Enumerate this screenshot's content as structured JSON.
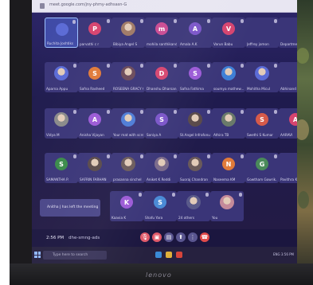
{
  "photo_subject": "laptop-screen-video-call",
  "browser": {
    "url_text": "meet.google.com/jny-phmy-adhsasn-G"
  },
  "participants": [
    {
      "name": "Ruchita Joshtiks",
      "initial": "",
      "color": "#3f4aa6",
      "kind": "self"
    },
    {
      "name": "parvathi c r",
      "initial": "P",
      "color": "#d6446f",
      "kind": "letter"
    },
    {
      "name": "Bibiya Angel S",
      "initial": "",
      "color": "#a07a66",
      "kind": "photo"
    },
    {
      "name": "mohila santhikand...",
      "initial": "m",
      "color": "#c94a92",
      "kind": "letter"
    },
    {
      "name": "Amala A.K",
      "initial": "A",
      "color": "#7a54c8",
      "kind": "letter"
    },
    {
      "name": "Varun Babu",
      "initial": "V",
      "color": "#d6446f",
      "kind": "letter"
    },
    {
      "name": "Jeffrey jomon",
      "initial": "",
      "color": "#3a3578",
      "kind": "blank"
    },
    {
      "name": "Department of E...",
      "initial": "",
      "color": "#3a3578",
      "kind": "blank"
    },
    {
      "name": "Aparna Appu",
      "initial": "",
      "color": "#5b6bd6",
      "kind": "photo"
    },
    {
      "name": "Safna Rasheed",
      "initial": "S",
      "color": "#e07a3a",
      "kind": "letter"
    },
    {
      "name": "ROSEENA GRACY G",
      "initial": "",
      "color": "#6b4a5a",
      "kind": "photo"
    },
    {
      "name": "Dhanshu Dharsan...",
      "initial": "D",
      "color": "#d6446f",
      "kind": "letter"
    },
    {
      "name": "Safna Fathima",
      "initial": "S",
      "color": "#9b5ad6",
      "kind": "letter"
    },
    {
      "name": "soumya mathew...",
      "initial": "",
      "color": "#3f7fd6",
      "kind": "photo"
    },
    {
      "name": "Mohitha Micul",
      "initial": "",
      "color": "#5b6bd6",
      "kind": "photo"
    },
    {
      "name": "Abhinand",
      "initial": "",
      "color": "#3a3578",
      "kind": "blank"
    },
    {
      "name": "Vidya M",
      "initial": "",
      "color": "#8a8a8a",
      "kind": "photo"
    },
    {
      "name": "Anisha Vijayan",
      "initial": "A",
      "color": "#9b5ad6",
      "kind": "letter"
    },
    {
      "name": "Your mat with screenshot",
      "initial": "",
      "color": "#4d7bd6",
      "kind": "photo"
    },
    {
      "name": "Soniya A",
      "initial": "S",
      "color": "#7a54c8",
      "kind": "letter"
    },
    {
      "name": "St.Angel Infrafonul",
      "initial": "",
      "color": "#5a4a4a",
      "kind": "photo"
    },
    {
      "name": "Athira TB",
      "initial": "",
      "color": "#6a7a6a",
      "kind": "photo"
    },
    {
      "name": "Swethi S Kumar",
      "initial": "S",
      "color": "#d65a4a",
      "kind": "letter"
    },
    {
      "name": "AARAVI",
      "initial": "A",
      "color": "#d6446f",
      "kind": "letter"
    },
    {
      "name": "SAMANTHA P.",
      "initial": "S",
      "color": "#3a8a4a",
      "kind": "letter"
    },
    {
      "name": "SAFRIN FARHAN",
      "initial": "",
      "color": "#5a4a4a",
      "kind": "photo"
    },
    {
      "name": "prasanna sinchel",
      "initial": "",
      "color": "#6a5a5a",
      "kind": "photo"
    },
    {
      "name": "Aniket K Reddi",
      "initial": "",
      "color": "#7a6a8a",
      "kind": "photo"
    },
    {
      "name": "Suoraj Chandran",
      "initial": "",
      "color": "#6a5a5a",
      "kind": "photo"
    },
    {
      "name": "Naseema KM",
      "initial": "N",
      "color": "#e07a3a",
      "kind": "letter"
    },
    {
      "name": "Gowtham Gowrik...",
      "initial": "G",
      "color": "#4a8a5a",
      "kind": "letter"
    },
    {
      "name": "Pavithra Kotaikor",
      "initial": "",
      "color": "#3a8a4a",
      "kind": "blank"
    },
    {
      "name": "Kaavia K",
      "initial": "K",
      "color": "#9b5ad6",
      "kind": "letter"
    },
    {
      "name": "Shafu Yara",
      "initial": "S",
      "color": "#4a8ad6",
      "kind": "letter"
    },
    {
      "name": "24 others",
      "initial": "",
      "color": "#5a5a8a",
      "kind": "photo"
    },
    {
      "name": "You",
      "initial": "",
      "color": "#c48a9a",
      "kind": "photo"
    }
  ],
  "notice": {
    "text": "Anitha J has left the meeting"
  },
  "footer": {
    "time": "2:56 PM",
    "meeting_code": "dhe-smng-ads"
  },
  "controls": [
    {
      "name": "mic-off-button",
      "color": "#e05a6a",
      "glyph": "🎙"
    },
    {
      "name": "camera-off-button",
      "color": "#e05a6a",
      "glyph": "▣"
    },
    {
      "name": "captions-button",
      "color": "#5a5690",
      "glyph": "▤"
    },
    {
      "name": "present-button",
      "color": "#5a5690",
      "glyph": "⬆"
    },
    {
      "name": "more-options-button",
      "color": "#5a5690",
      "glyph": "⋮"
    },
    {
      "name": "leave-call-button",
      "color": "#e04a4a",
      "glyph": "☎"
    }
  ],
  "taskbar": {
    "search_placeholder": "Type here to search",
    "tray_text": "ENG 3:56 PM"
  },
  "brand": "lenovo"
}
